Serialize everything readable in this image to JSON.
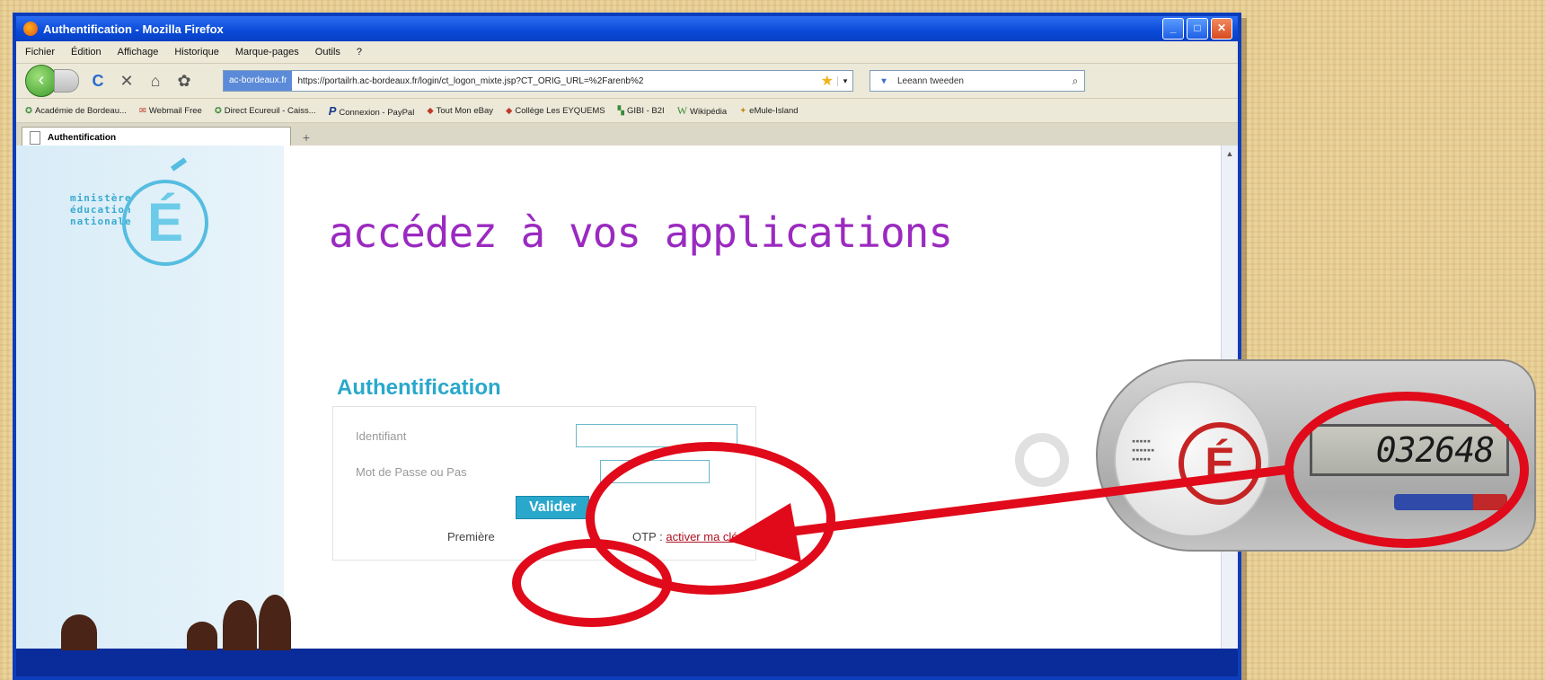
{
  "window": {
    "title": "Authentification - Mozilla Firefox",
    "buttons": [
      "_",
      "□",
      "✕"
    ]
  },
  "menubar": [
    "Fichier",
    "Édition",
    "Affichage",
    "Historique",
    "Marque-pages",
    "Outils",
    "?"
  ],
  "navbar": {
    "site_identity": "ac-bordeaux.fr",
    "url": "https://portailrh.ac-bordeaux.fr/login/ct_logon_mixte.jsp?CT_ORIG_URL=%2Farenb%2",
    "search_value": "Leeann tweeden"
  },
  "bookmarks": [
    {
      "icon": "globe-icon",
      "label": "Académie de Bordeau..."
    },
    {
      "icon": "mail-icon",
      "label": "Webmail Free"
    },
    {
      "icon": "globe-icon",
      "label": "Direct Ecureuil - Caiss..."
    },
    {
      "icon": "paypal-icon",
      "label": "Connexion - PayPal"
    },
    {
      "icon": "ebay-icon",
      "label": "Tout Mon eBay"
    },
    {
      "icon": "ebay-icon",
      "label": "Collège Les EYQUEMS"
    },
    {
      "icon": "gibi-icon",
      "label": "GIBI - B2I"
    },
    {
      "icon": "wikipedia-icon",
      "label": "Wikipédia"
    },
    {
      "icon": "emule-icon",
      "label": "eMule-Island"
    }
  ],
  "tab": {
    "label": "Authentification",
    "new_tab": "+"
  },
  "page": {
    "heading": "accédez à vos applications",
    "logo_lines": [
      "ministère",
      "éducation",
      "nationale"
    ],
    "logo_letter": "É",
    "auth_title": "Authentification",
    "username_label": "Identifiant",
    "password_label": "Mot de Passe ou Pas",
    "submit_label": "Valider",
    "otp_prefix": "Première",
    "otp_mid": "OTP :",
    "otp_link": "activer ma clé"
  },
  "token": {
    "display": "032648",
    "letter": "É"
  },
  "colors": {
    "heading": "#9b2ac0",
    "auth_title": "#2aa8cc",
    "annotation": "#e00a1a",
    "background": "#e8cf95"
  }
}
